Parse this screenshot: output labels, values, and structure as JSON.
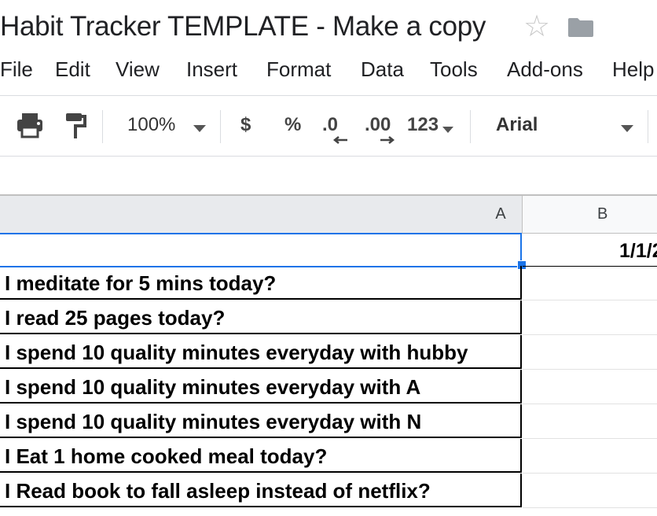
{
  "app": {
    "title": "Habit Tracker TEMPLATE - Make a copy",
    "star_icon": "star-icon",
    "folder_icon": "folder-icon"
  },
  "menu": [
    "File",
    "Edit",
    "View",
    "Insert",
    "Format",
    "Data",
    "Tools",
    "Add-ons",
    "Help"
  ],
  "toolbar": {
    "zoom": "100%",
    "currency": "$",
    "percent": "%",
    "decrease_decimal": ".0",
    "increase_decimal": ".00",
    "more_formats": "123",
    "font": "Arial",
    "icons": [
      "print-icon",
      "paint-format-icon",
      "chevron-down-icon"
    ]
  },
  "sheet": {
    "columns": [
      "A",
      "B"
    ],
    "b1_value": "1/1/2",
    "rows": [
      "I meditate for 5 mins today?",
      "I read 25 pages today?",
      "I spend 10 quality minutes everyday with hubby",
      "I spend 10 quality minutes everyday with A",
      "I spend 10 quality minutes everyday with N",
      "I Eat 1 home cooked meal today?",
      "I Read book to fall asleep instead of netflix?"
    ]
  },
  "colors": {
    "selection": "#1a73e8",
    "header_bg": "#e8eaed",
    "grid": "#e2e2e2"
  }
}
